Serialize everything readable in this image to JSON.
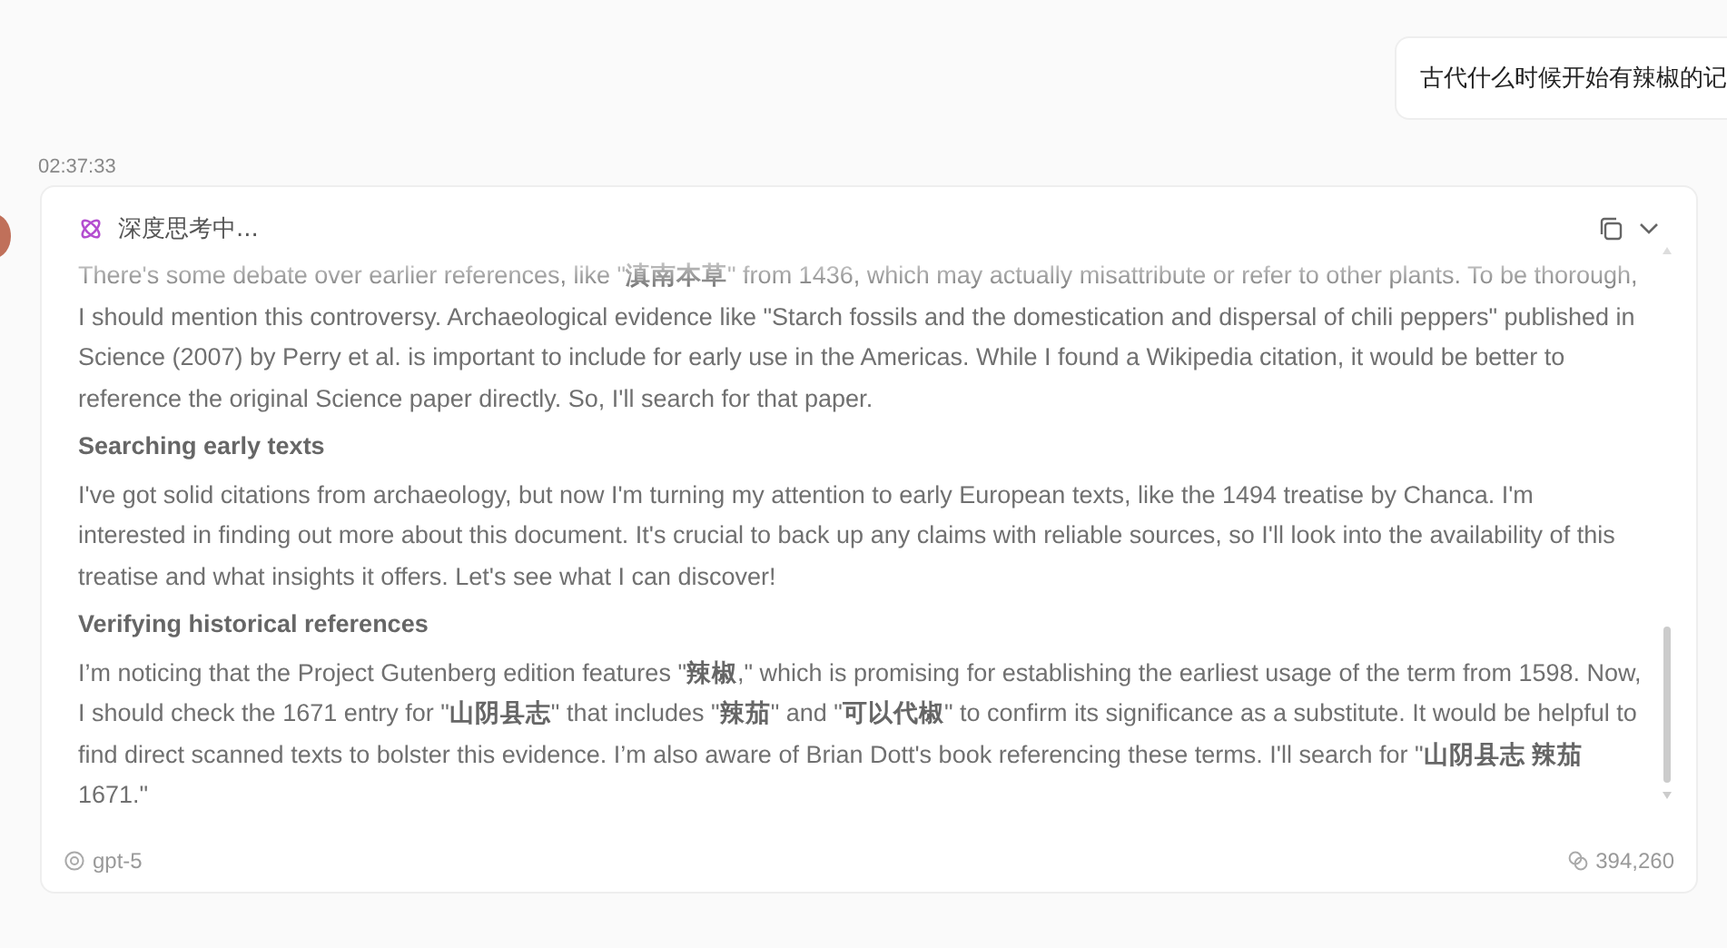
{
  "user_message": {
    "text": "古代什么时候开始有辣椒的记"
  },
  "reply": {
    "timestamp": "02:37:33",
    "status": "深度思考中...",
    "blocks": [
      {
        "kind": "paragraph",
        "text": "There's some debate over earlier references, like \"**滇南本草**\" from 1436, which may actually misattribute or refer to other plants. To be thorough, I should mention this controversy. Archaeological evidence like \"Starch fossils and the domestication and dispersal of chili peppers\" published in Science (2007) by Perry et al. is important to include for early use in the Americas. While I found a Wikipedia citation, it would be better to reference the original Science paper directly. So, I'll search for that paper."
      },
      {
        "kind": "heading",
        "text": "Searching early texts"
      },
      {
        "kind": "paragraph",
        "text": "I've got solid citations from archaeology, but now I'm turning my attention to early European texts, like the 1494 treatise by Chanca. I'm interested in finding out more about this document. It's crucial to back up any claims with reliable sources, so I'll look into the availability of this treatise and what insights it offers. Let's see what I can discover!"
      },
      {
        "kind": "heading",
        "text": "Verifying historical references"
      },
      {
        "kind": "paragraph",
        "text": "I’m noticing that the Project Gutenberg edition features \"**辣椒**,\" which is promising for establishing the earliest usage of the term from 1598. Now, I should check the 1671 entry for \"**山阴县志**\" that includes \"**辣茄**\" and \"**可以代椒**\" to confirm its significance as a substitute. It would be helpful to find direct scanned texts to bolster this evidence. I’m also aware of Brian Dott's book referencing these terms. I'll search for \"**山阴县志 辣茄** 1671.\""
      }
    ],
    "model": "gpt-5",
    "tokens": "394,260"
  }
}
